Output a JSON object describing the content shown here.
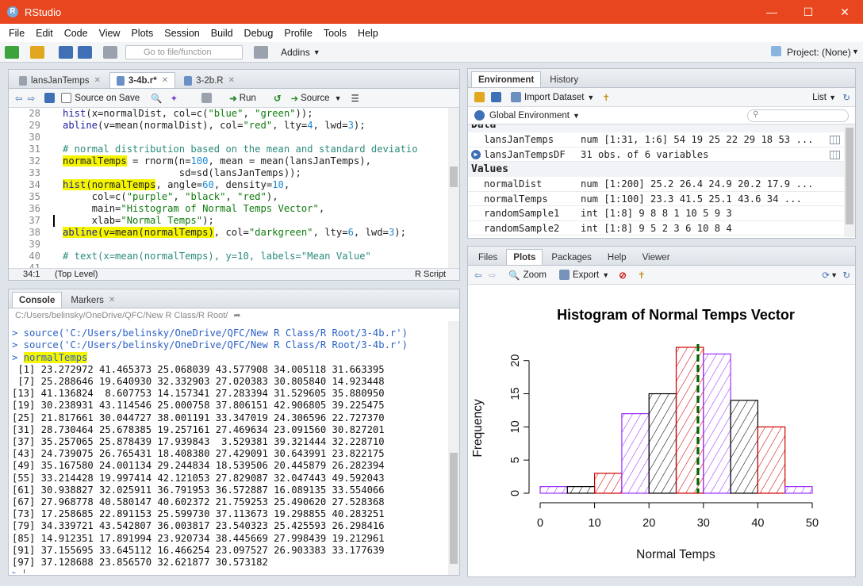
{
  "window": {
    "title": "RStudio"
  },
  "menu": [
    "File",
    "Edit",
    "Code",
    "View",
    "Plots",
    "Session",
    "Build",
    "Debug",
    "Profile",
    "Tools",
    "Help"
  ],
  "toolbar": {
    "goto_placeholder": "Go to file/function",
    "addins": "Addins",
    "project": "Project: (None)"
  },
  "editor": {
    "tabs": [
      {
        "label": "lansJanTemps",
        "active": false
      },
      {
        "label": "3-4b.r*",
        "active": true
      },
      {
        "label": "3-2b.R",
        "active": false
      }
    ],
    "source_on_save": "Source on Save",
    "run": "Run",
    "source": "Source",
    "line_numbers": [
      "28",
      "29",
      "30",
      "31",
      "32",
      "33",
      "34",
      "35",
      "36",
      "37",
      "38",
      "39",
      "40",
      "41"
    ],
    "cursor_position": "34:1",
    "scope": "(Top Level)",
    "file_type": "R Script"
  },
  "console": {
    "tabs": [
      "Console",
      "Markers"
    ],
    "path": "C:/Users/belinsky/OneDrive/QFC/New R Class/R Root/",
    "source_line_1": "> source('C:/Users/belinsky/OneDrive/QFC/New R Class/R Root/3-4b.r')",
    "source_line_2": "> source('C:/Users/belinsky/OneDrive/QFC/New R Class/R Root/3-4b.r')",
    "command": "normalTemps",
    "output": [
      " [1] 23.272972 41.465373 25.068039 43.577908 34.005118 31.663395",
      " [7] 25.288646 19.640930 32.332903 27.020383 30.805840 14.923448",
      "[13] 41.136824  8.607753 14.157341 27.283394 31.529605 35.880950",
      "[19] 30.238931 43.114546 25.000758 37.806151 42.906805 39.225475",
      "[25] 21.817661 30.044727 38.001191 33.347019 24.306596 22.727370",
      "[31] 28.730464 25.678385 19.257161 27.469634 23.091560 30.827201",
      "[37] 35.257065 25.878439 17.939843  3.529381 39.321444 32.228710",
      "[43] 24.739075 26.765431 18.408380 27.429091 30.643991 23.822175",
      "[49] 35.167580 24.001134 29.244834 18.539506 20.445879 26.282394",
      "[55] 33.214428 19.997414 42.121053 27.829087 32.047443 49.592043",
      "[61] 30.938827 32.025911 36.791953 36.572887 16.089135 33.554066",
      "[67] 27.968778 40.580147 40.602372 21.759253 25.490620 27.528368",
      "[73] 17.258685 22.891153 25.599730 37.113673 19.298855 40.283251",
      "[79] 34.339721 43.542807 36.003817 23.540323 25.425593 26.298416",
      "[85] 14.912351 17.891994 23.920734 38.445669 27.998439 19.212961",
      "[91] 37.155695 33.645112 16.466254 23.097527 26.903383 33.177639",
      "[97] 37.128688 23.856570 32.621877 30.573182"
    ]
  },
  "environment": {
    "tabs": [
      "Environment",
      "History"
    ],
    "import_dataset": "Import Dataset",
    "list_view": "List",
    "scope": "Global Environment",
    "data_header": "Data",
    "values_header": "Values",
    "data": [
      {
        "name": "lansJanTemps",
        "value": "num [1:31, 1:6] 54 19 25 22 29 18 53 ..."
      },
      {
        "name": "lansJanTempsDF",
        "value": "31 obs. of 6 variables"
      }
    ],
    "values": [
      {
        "name": "normalDist",
        "value": "num [1:200] 25.2 26.4 24.9 20.2 17.9 ..."
      },
      {
        "name": "normalTemps",
        "value": "num [1:100] 23.3 41.5 25.1 43.6 34 ..."
      },
      {
        "name": "randomSample1",
        "value": "int [1:8] 9 8 8 1 10 5 9 3"
      },
      {
        "name": "randomSample2",
        "value": "int [1:8] 9 5 2 3 6 10 8 4"
      }
    ]
  },
  "files_pane": {
    "tabs": [
      "Files",
      "Plots",
      "Packages",
      "Help",
      "Viewer"
    ],
    "active_tab": "Plots",
    "zoom": "Zoom",
    "export": "Export"
  },
  "chart_data": {
    "type": "bar",
    "title": "Histogram of Normal Temps Vector",
    "xlabel": "Normal Temps",
    "ylabel": "Frequency",
    "bin_edges": [
      0,
      5,
      10,
      15,
      20,
      25,
      30,
      35,
      40,
      45,
      50
    ],
    "values": [
      1,
      1,
      3,
      12,
      15,
      22,
      21,
      14,
      10,
      1
    ],
    "bar_colors": [
      "#9b30ff",
      "#000000",
      "#d00000",
      "#9b30ff",
      "#000000",
      "#d00000",
      "#9b30ff",
      "#000000",
      "#d00000",
      "#9b30ff"
    ],
    "xlim": [
      0,
      50
    ],
    "ylim": [
      0,
      22
    ],
    "xticks": [
      "0",
      "10",
      "20",
      "30",
      "40",
      "50"
    ],
    "yticks": [
      "0",
      "5",
      "10",
      "15",
      "20"
    ],
    "mean_line": {
      "x": 29.0,
      "color": "#006400"
    }
  }
}
